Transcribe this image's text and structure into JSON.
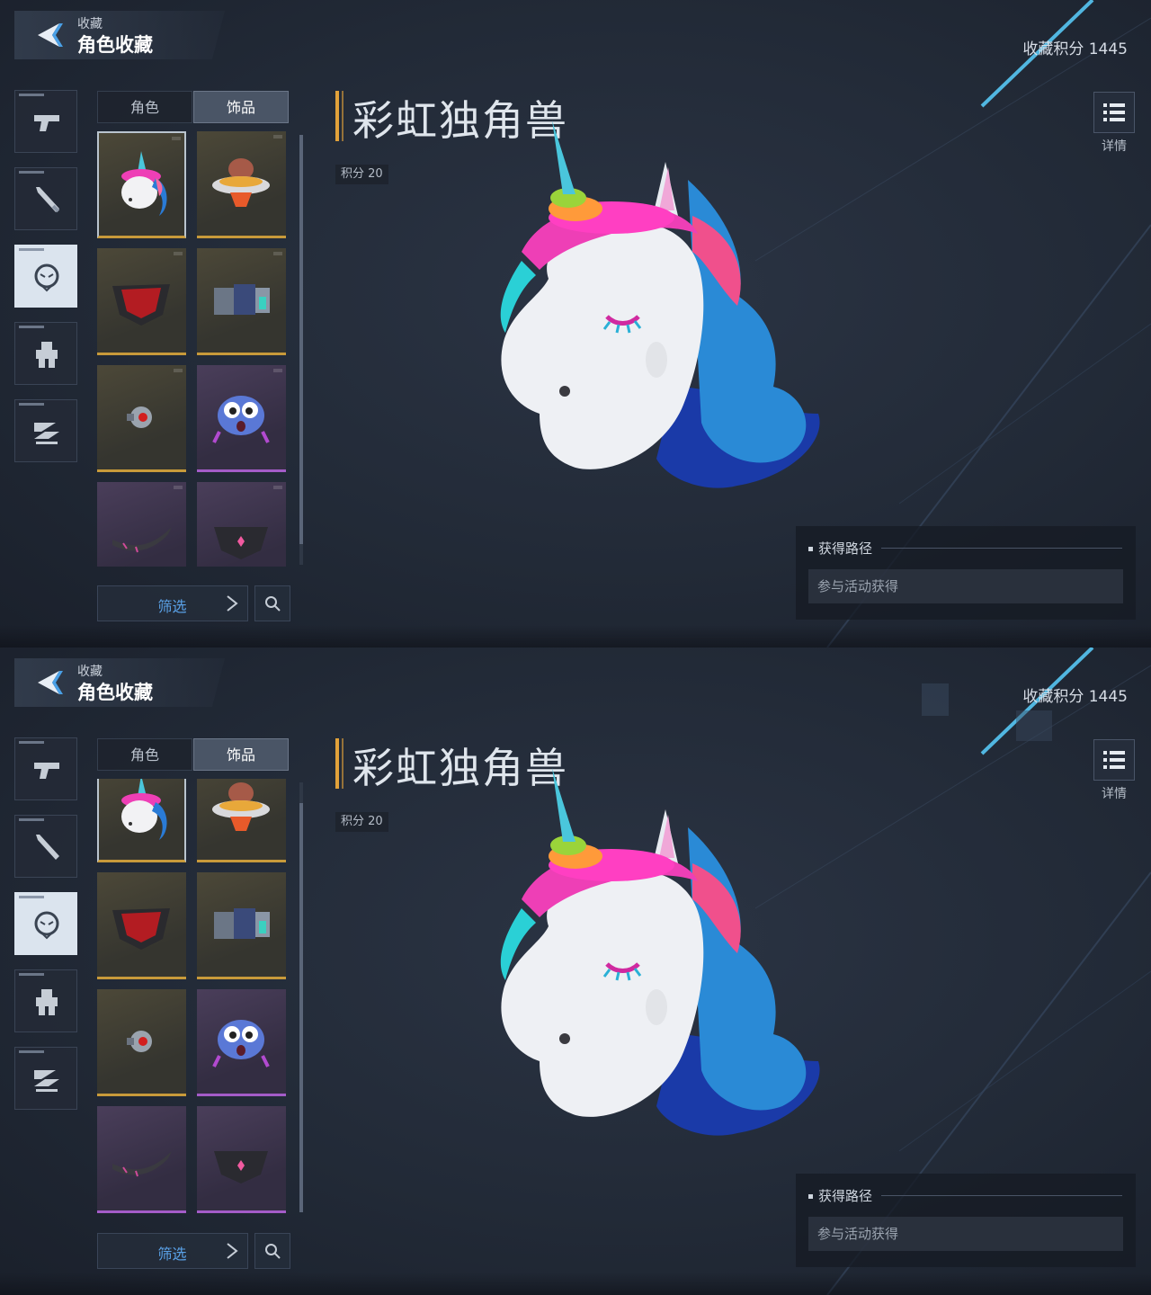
{
  "header": {
    "crumb": "收藏",
    "title": "角色收藏"
  },
  "score_total": "收藏积分 1445",
  "categories": [
    {
      "icon": "pistol-icon",
      "active": false
    },
    {
      "icon": "melee-weapon-icon",
      "active": false
    },
    {
      "icon": "character-head-icon",
      "active": true
    },
    {
      "icon": "mech-icon",
      "active": false
    },
    {
      "icon": "vehicle-icon",
      "active": false
    }
  ],
  "tabs": {
    "characters": "角色",
    "accessories": "饰品",
    "active": "accessories"
  },
  "grid_items": [
    {
      "icon": "unicorn-head-icon",
      "rarity": "gold",
      "selected": true
    },
    {
      "icon": "capybara-ufo-icon",
      "rarity": "gold",
      "selected": false
    },
    {
      "icon": "red-mask-icon",
      "rarity": "gold",
      "selected": false
    },
    {
      "icon": "armor-piece-icon",
      "rarity": "gold",
      "selected": false
    },
    {
      "icon": "eye-device-icon",
      "rarity": "gold",
      "selected": false
    },
    {
      "icon": "blue-monster-icon",
      "rarity": "purple",
      "selected": false
    },
    {
      "icon": "blade-horn-icon",
      "rarity": "purple",
      "selected": false
    },
    {
      "icon": "face-mask-icon",
      "rarity": "purple",
      "selected": false
    }
  ],
  "filter": {
    "label": "筛选"
  },
  "detail": {
    "name": "彩虹独角兽",
    "points_label": "积分",
    "points_value": "20",
    "details_label": "详情",
    "source_title": "获得路径",
    "source_value": "参与活动获得"
  },
  "colors": {
    "accent_gold": "#e2a23a",
    "filter_blue": "#5aa2e8",
    "rarity_gold": "#c89a3a",
    "rarity_purple": "#a45cc8"
  }
}
